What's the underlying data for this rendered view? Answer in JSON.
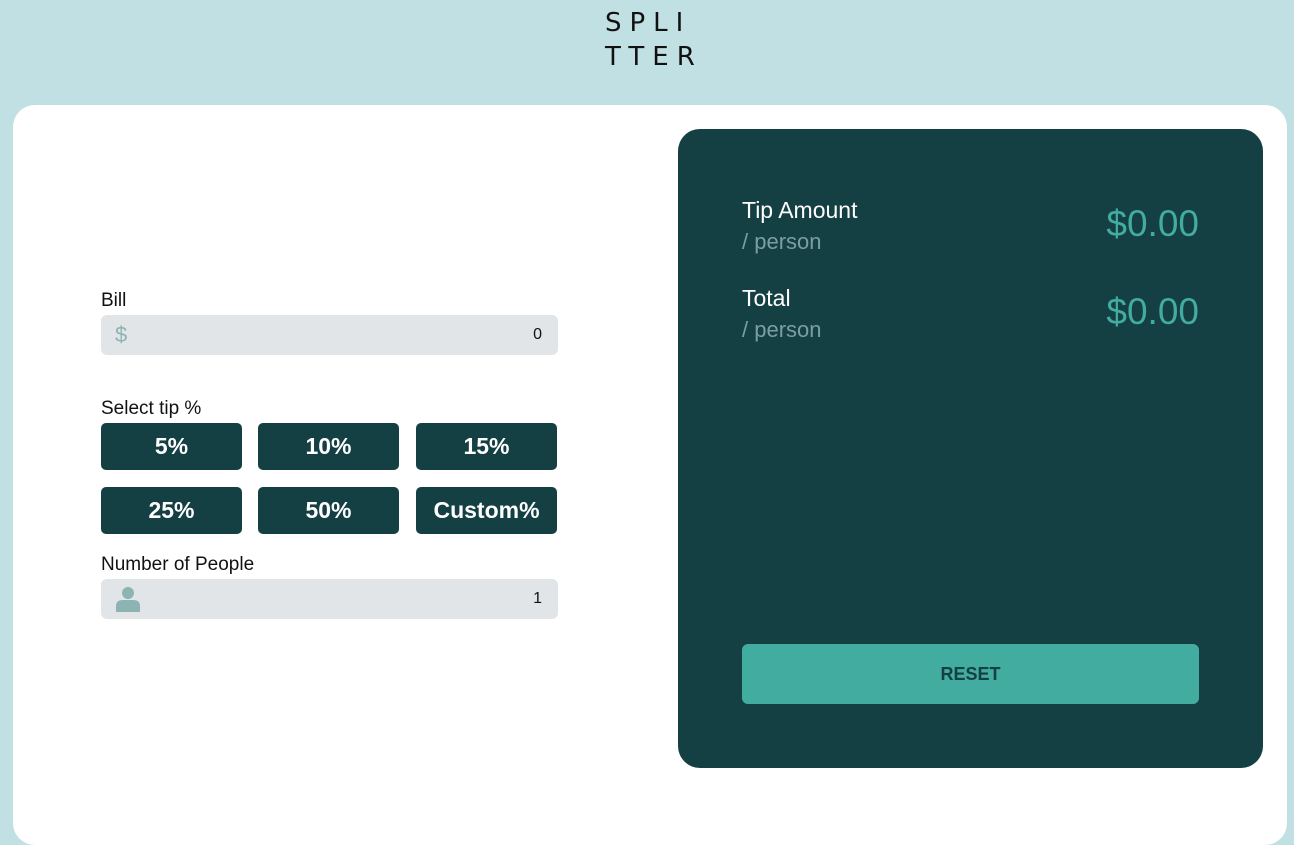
{
  "logo": {
    "line1": "SPLI",
    "line2": "TTER"
  },
  "bill": {
    "label": "Bill",
    "currency_icon": "$",
    "value": "0"
  },
  "tip": {
    "label": "Select tip %",
    "options": [
      "5%",
      "10%",
      "15%",
      "25%",
      "50%",
      "Custom%"
    ]
  },
  "people": {
    "label": "Number of People",
    "icon": "person-icon",
    "value": "1"
  },
  "results": {
    "tip_amount": {
      "title": "Tip Amount",
      "sub": "/ person",
      "value": "$0.00"
    },
    "total": {
      "title": "Total",
      "sub": "/ person",
      "value": "$0.00"
    },
    "reset_label": "RESET"
  },
  "colors": {
    "background": "#c1e0e4",
    "dark_teal": "#143f43",
    "accent": "#41ac9f",
    "input_bg": "#e1e5e8",
    "muted": "#7b9fa0"
  }
}
